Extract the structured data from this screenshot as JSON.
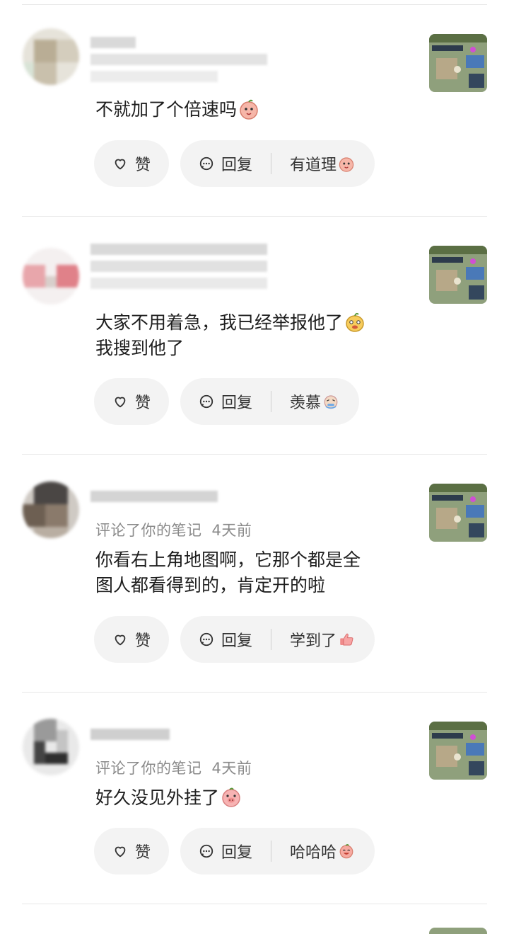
{
  "comments": [
    {
      "meta_action": "",
      "meta_time": "",
      "lines": [
        "不就加了个倍速吗"
      ],
      "like_label": "赞",
      "reply_label": "回复",
      "quick_reply": "有道理"
    },
    {
      "meta_action": "",
      "meta_time": "",
      "lines": [
        "大家不用着急，我已经举报他了",
        "我搜到他了"
      ],
      "like_label": "赞",
      "reply_label": "回复",
      "quick_reply": "羡慕"
    },
    {
      "meta_action": "评论了你的笔记",
      "meta_time": "4天前",
      "lines": [
        "你看右上角地图啊，它那个都是全",
        "图人都看得到的，肯定开的啦"
      ],
      "like_label": "赞",
      "reply_label": "回复",
      "quick_reply": "学到了"
    },
    {
      "meta_action": "评论了你的笔记",
      "meta_time": "4天前",
      "lines": [
        "好久没见外挂了"
      ],
      "like_label": "赞",
      "reply_label": "回复",
      "quick_reply": "哈哈哈"
    }
  ],
  "icons": {
    "like": "heart-outline-icon",
    "reply": "chat-bubble-icon"
  },
  "colors": {
    "pill_bg": "#f3f3f3",
    "meta_text": "#8a8a8a",
    "divider": "#e8e8e8"
  }
}
